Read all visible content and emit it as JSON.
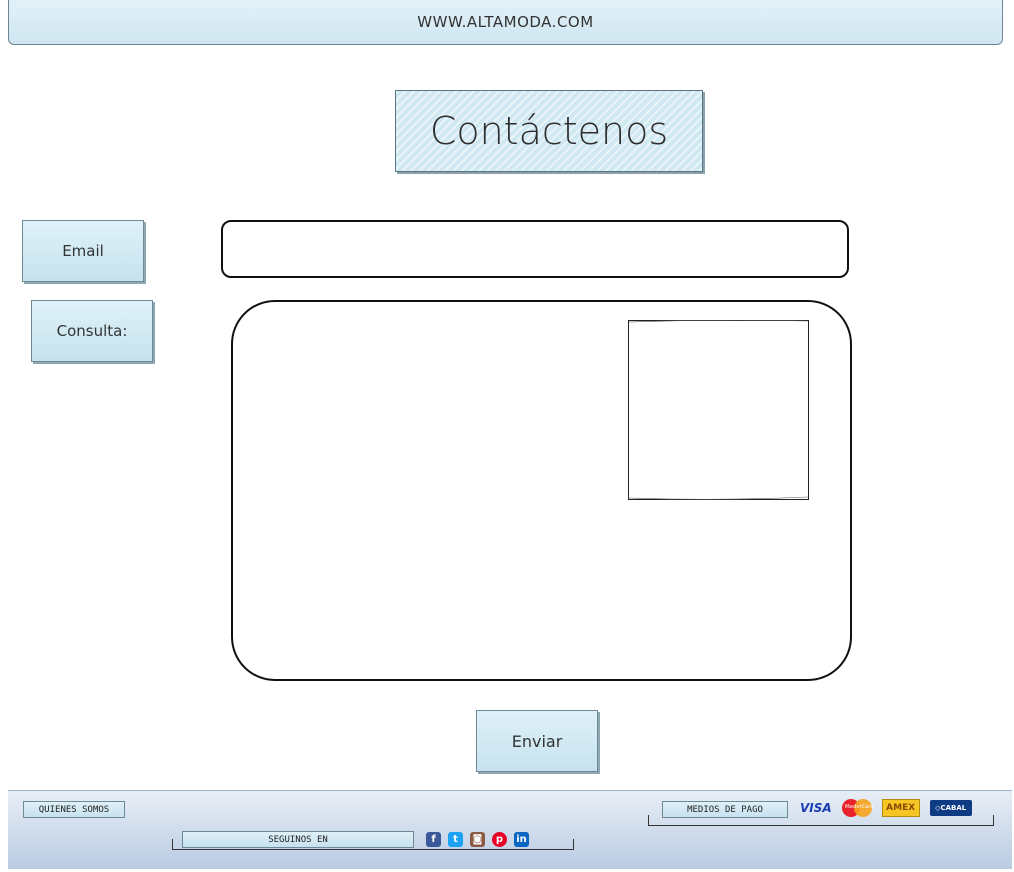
{
  "header": {
    "url": "WWW.ALTAMODA.COM"
  },
  "page": {
    "title": "Contáctenos"
  },
  "form": {
    "email_label": "Email",
    "email_value": "",
    "consulta_label": "Consulta:",
    "consulta_value": "",
    "send_label": "Enviar"
  },
  "footer": {
    "quienes_label": "QUIENES SOMOS",
    "seguinos_label": "SEGUINOS EN",
    "social": [
      {
        "name": "facebook-icon",
        "glyph": "f",
        "color": "#3b5998"
      },
      {
        "name": "twitter-icon",
        "glyph": "t",
        "color": "#1da1f2"
      },
      {
        "name": "instagram-icon",
        "glyph": "◙",
        "color": "#8a5a44"
      },
      {
        "name": "pinterest-icon",
        "glyph": "p",
        "color": "#e60023"
      },
      {
        "name": "linkedin-icon",
        "glyph": "in",
        "color": "#0a66c2"
      }
    ],
    "medios_label": "MEDIOS DE PAGO",
    "payments": {
      "visa": "VISA",
      "mastercard": "MasterCard",
      "amex": "AMEX",
      "cabal": "◇CABAL"
    }
  },
  "colors": {
    "accent": "#cfe8f2",
    "border": "#6e8a96",
    "footer_top": "#e8eef6",
    "footer_bottom": "#b9cbe2"
  }
}
